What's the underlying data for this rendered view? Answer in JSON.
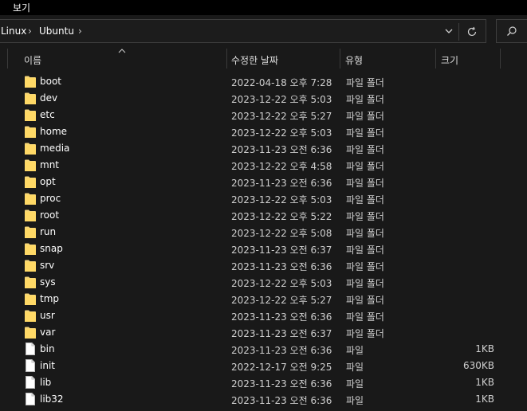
{
  "menu": {
    "view_label": "보기"
  },
  "address": {
    "crumbs": [
      "Linux",
      "Ubuntu"
    ],
    "separator": "›"
  },
  "columns": {
    "name": "이름",
    "date": "수정한 날짜",
    "type": "유형",
    "size": "크기"
  },
  "rows": [
    {
      "name": "boot",
      "date": "2022-04-18 오후 7:28",
      "type": "파일 폴더",
      "size": "",
      "kind": "folder"
    },
    {
      "name": "dev",
      "date": "2023-12-22 오후 5:03",
      "type": "파일 폴더",
      "size": "",
      "kind": "folder"
    },
    {
      "name": "etc",
      "date": "2023-12-22 오후 5:27",
      "type": "파일 폴더",
      "size": "",
      "kind": "folder"
    },
    {
      "name": "home",
      "date": "2023-12-22 오후 5:03",
      "type": "파일 폴더",
      "size": "",
      "kind": "folder"
    },
    {
      "name": "media",
      "date": "2023-11-23 오전 6:36",
      "type": "파일 폴더",
      "size": "",
      "kind": "folder"
    },
    {
      "name": "mnt",
      "date": "2023-12-22 오후 4:58",
      "type": "파일 폴더",
      "size": "",
      "kind": "folder"
    },
    {
      "name": "opt",
      "date": "2023-11-23 오전 6:36",
      "type": "파일 폴더",
      "size": "",
      "kind": "folder"
    },
    {
      "name": "proc",
      "date": "2023-12-22 오후 5:03",
      "type": "파일 폴더",
      "size": "",
      "kind": "folder"
    },
    {
      "name": "root",
      "date": "2023-12-22 오후 5:22",
      "type": "파일 폴더",
      "size": "",
      "kind": "folder"
    },
    {
      "name": "run",
      "date": "2023-12-22 오후 5:08",
      "type": "파일 폴더",
      "size": "",
      "kind": "folder"
    },
    {
      "name": "snap",
      "date": "2023-11-23 오전 6:37",
      "type": "파일 폴더",
      "size": "",
      "kind": "folder"
    },
    {
      "name": "srv",
      "date": "2023-11-23 오전 6:36",
      "type": "파일 폴더",
      "size": "",
      "kind": "folder"
    },
    {
      "name": "sys",
      "date": "2023-12-22 오후 5:03",
      "type": "파일 폴더",
      "size": "",
      "kind": "folder"
    },
    {
      "name": "tmp",
      "date": "2023-12-22 오후 5:27",
      "type": "파일 폴더",
      "size": "",
      "kind": "folder"
    },
    {
      "name": "usr",
      "date": "2023-11-23 오전 6:36",
      "type": "파일 폴더",
      "size": "",
      "kind": "folder"
    },
    {
      "name": "var",
      "date": "2023-11-23 오전 6:37",
      "type": "파일 폴더",
      "size": "",
      "kind": "folder"
    },
    {
      "name": "bin",
      "date": "2023-11-23 오전 6:36",
      "type": "파일",
      "size": "1KB",
      "kind": "file"
    },
    {
      "name": "init",
      "date": "2022-12-17 오전 9:25",
      "type": "파일",
      "size": "630KB",
      "kind": "file"
    },
    {
      "name": "lib",
      "date": "2023-11-23 오전 6:36",
      "type": "파일",
      "size": "1KB",
      "kind": "file"
    },
    {
      "name": "lib32",
      "date": "2023-11-23 오전 6:36",
      "type": "파일",
      "size": "1KB",
      "kind": "file"
    }
  ],
  "colors": {
    "background": "#191919",
    "folder": "#f8d775",
    "file": "#ffffff"
  }
}
